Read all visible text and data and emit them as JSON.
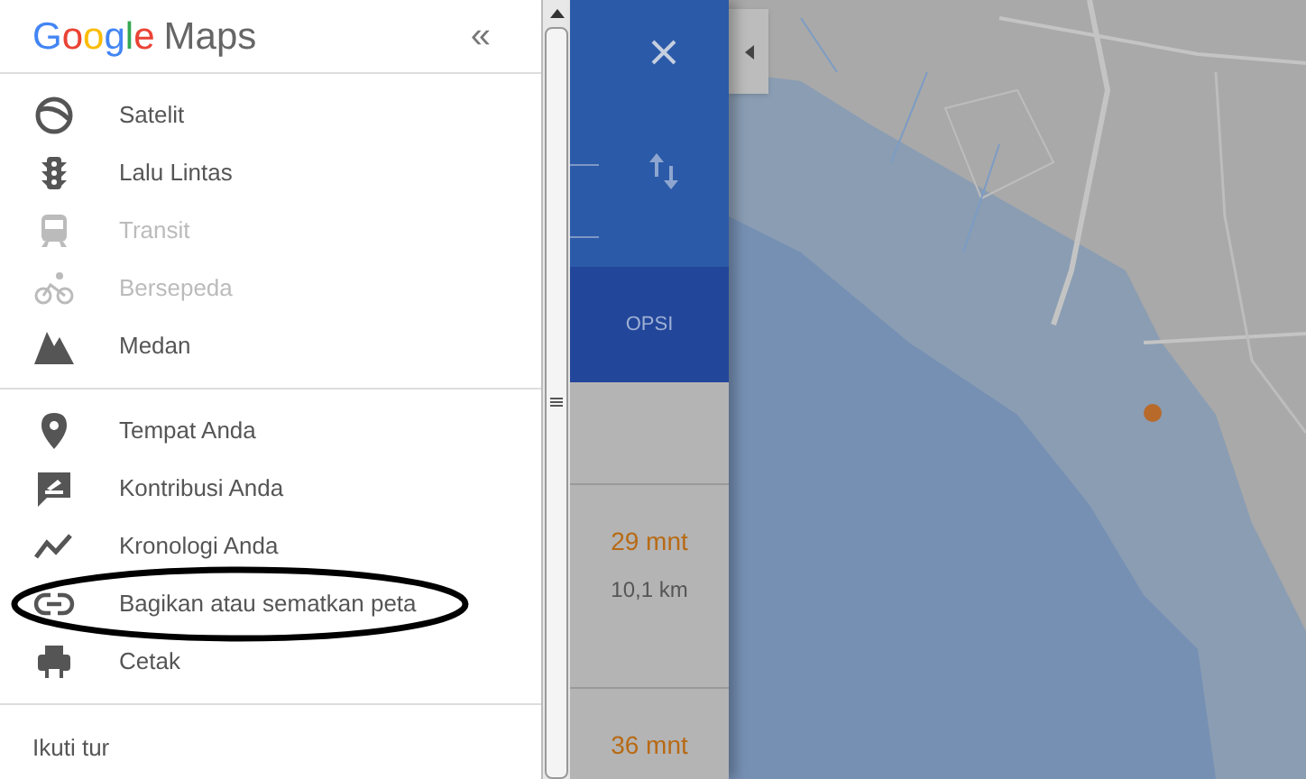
{
  "header": {
    "logo_brand": "Google",
    "logo_product": "Maps",
    "collapse": "«"
  },
  "menu_groups": [
    [
      {
        "label": "Satelit",
        "disabled": false,
        "circled": false
      },
      {
        "label": "Lalu Lintas",
        "disabled": false,
        "circled": false
      },
      {
        "label": "Transit",
        "disabled": true,
        "circled": false
      },
      {
        "label": "Bersepeda",
        "disabled": true,
        "circled": false
      },
      {
        "label": "Medan",
        "disabled": false,
        "circled": false
      }
    ],
    [
      {
        "label": "Tempat Anda",
        "disabled": false,
        "circled": false
      },
      {
        "label": "Kontribusi Anda",
        "disabled": false,
        "circled": false
      },
      {
        "label": "Kronologi Anda",
        "disabled": false,
        "circled": false
      },
      {
        "label": "Bagikan atau sematkan peta",
        "disabled": false,
        "circled": true
      },
      {
        "label": "Cetak",
        "disabled": false,
        "circled": false
      }
    ]
  ],
  "footer_link": "Ikuti tur",
  "directions": {
    "options_button": "OPSI",
    "routes": [
      {
        "duration": "29 mnt",
        "distance": "10,1 km"
      },
      {
        "duration": "36 mnt"
      }
    ]
  }
}
